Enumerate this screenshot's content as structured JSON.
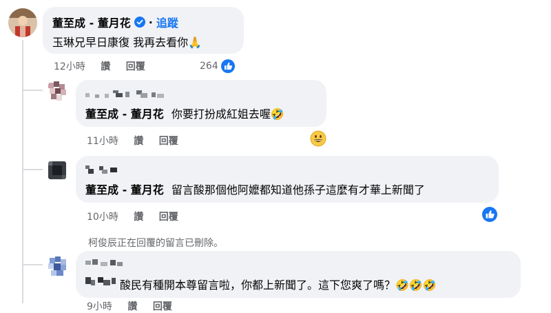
{
  "comments": [
    {
      "author": "董至成 - 董月花",
      "verified": true,
      "follow_label": "追蹤",
      "text": "玉琳兄早日康復 我再去看你🙏",
      "time": "12小時",
      "like_label": "讚",
      "reply_label": "回覆",
      "reaction_count": "264",
      "reaction_icon": "like-icon"
    },
    {
      "mention": "董至成 - 董月花",
      "text": "你要打扮成紅姐去喔🤣",
      "time": "11小時",
      "like_label": "讚",
      "reply_label": "回覆",
      "reaction_icon": "grin-emoji"
    },
    {
      "mention": "董至成 - 董月花",
      "text": "留言酸那個他阿嬤都知道他孫子這麼有才華上新聞了",
      "time": "10小時",
      "like_label": "讚",
      "reply_label": "回覆",
      "reaction_icon": "like-icon"
    },
    {
      "deleted_notice": "柯俊辰正在回覆的留言已刪除。"
    },
    {
      "text": "酸民有種開本尊留言啦，你都上新聞了。這下您爽了嗎？🤣🤣🤣",
      "time": "9小時",
      "like_label": "讚",
      "reply_label": "回覆"
    }
  ],
  "colors": {
    "bubble": "#f0f2f5",
    "meta": "#65676b",
    "like_blue": "#1877f2",
    "verified_blue": "#1877f2"
  }
}
